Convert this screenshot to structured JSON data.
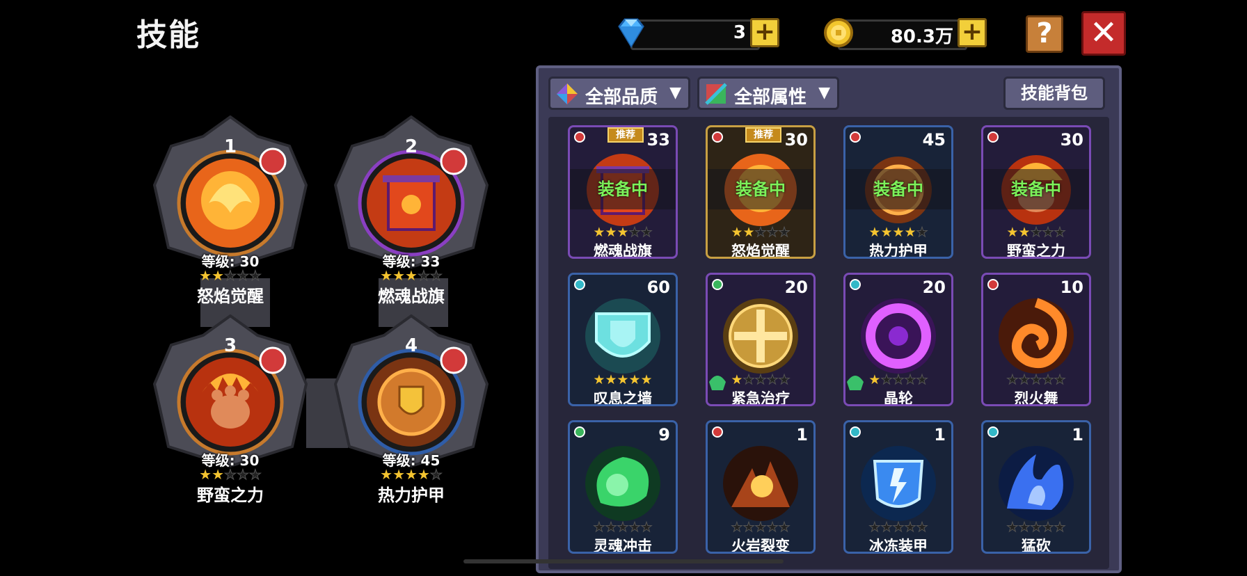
{
  "page": {
    "title": "技能"
  },
  "currency": {
    "gems": "3",
    "coins": "80.3万",
    "gem_icon": "diamond-icon",
    "coin_icon": "coin-icon"
  },
  "buttons": {
    "help": "?",
    "close": "✕"
  },
  "slots": [
    {
      "num": "1",
      "level": "等级: 30",
      "name": "怒焰觉醒",
      "stars": 2
    },
    {
      "num": "2",
      "level": "等级: 33",
      "name": "燃魂战旗",
      "stars": 3
    },
    {
      "num": "3",
      "level": "等级: 30",
      "name": "野蛮之力",
      "stars": 2
    },
    {
      "num": "4",
      "level": "等级: 45",
      "name": "热力护甲",
      "stars": 4
    }
  ],
  "filters": {
    "quality": "全部品质",
    "attribute": "全部属性",
    "bag": "技能背包"
  },
  "cards": [
    {
      "name": "燃魂战旗",
      "count": "33",
      "stars": 3,
      "equipped": "装备中",
      "recommend": "推荐"
    },
    {
      "name": "怒焰觉醒",
      "count": "30",
      "stars": 2,
      "equipped": "装备中",
      "recommend": "推荐"
    },
    {
      "name": "热力护甲",
      "count": "45",
      "stars": 4,
      "equipped": "装备中"
    },
    {
      "name": "野蛮之力",
      "count": "30",
      "stars": 2,
      "equipped": "装备中"
    },
    {
      "name": "叹息之墙",
      "count": "60",
      "stars": 5
    },
    {
      "name": "紧急治疗",
      "count": "20",
      "stars": 1
    },
    {
      "name": "晶轮",
      "count": "20",
      "stars": 1
    },
    {
      "name": "烈火舞",
      "count": "10",
      "stars": 0
    },
    {
      "name": "灵魂冲击",
      "count": "9",
      "stars": 0
    },
    {
      "name": "火岩裂变",
      "count": "1",
      "stars": 0
    },
    {
      "name": "冰冻装甲",
      "count": "1",
      "stars": 0
    },
    {
      "name": "猛砍",
      "count": "1",
      "stars": 0
    }
  ]
}
